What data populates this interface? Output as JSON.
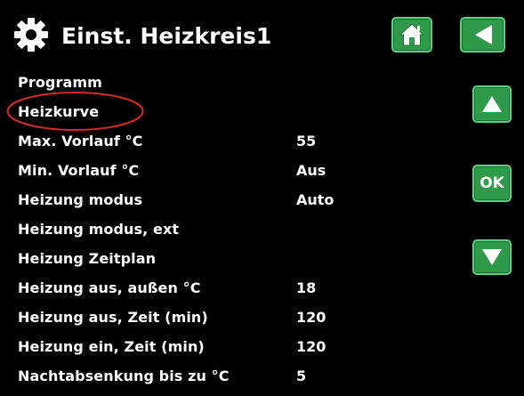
{
  "header": {
    "title": "Einst. Heizkreis1",
    "settings_icon": "gear-icon",
    "home_icon": "home-icon",
    "back_icon": "back-arrow-icon"
  },
  "menu": {
    "items": [
      {
        "label": "Programm",
        "value": ""
      },
      {
        "label": "Heizkurve",
        "value": ""
      },
      {
        "label": "Max. Vorlauf °C",
        "value": "55"
      },
      {
        "label": "Min. Vorlauf °C",
        "value": "Aus"
      },
      {
        "label": "Heizung modus",
        "value": "Auto"
      },
      {
        "label": "Heizung modus, ext",
        "value": ""
      },
      {
        "label": "Heizung Zeitplan",
        "value": ""
      },
      {
        "label": "Heizung aus, außen °C",
        "value": "18"
      },
      {
        "label": "Heizung aus, Zeit (min)",
        "value": "120"
      },
      {
        "label": "Heizung ein, Zeit (min)",
        "value": "120"
      },
      {
        "label": "Nachtabsenkung bis zu °C",
        "value": "5"
      }
    ],
    "highlighted_item": "Heizkurve"
  },
  "nav": {
    "up_icon": "up-arrow-icon",
    "ok_label": "OK",
    "down_icon": "down-arrow-icon"
  },
  "colors": {
    "background": "#000000",
    "button_green": "#2e9a4a",
    "button_border": "#5fd07e",
    "highlight_ring": "#d22a2a",
    "text": "#ffffff"
  }
}
